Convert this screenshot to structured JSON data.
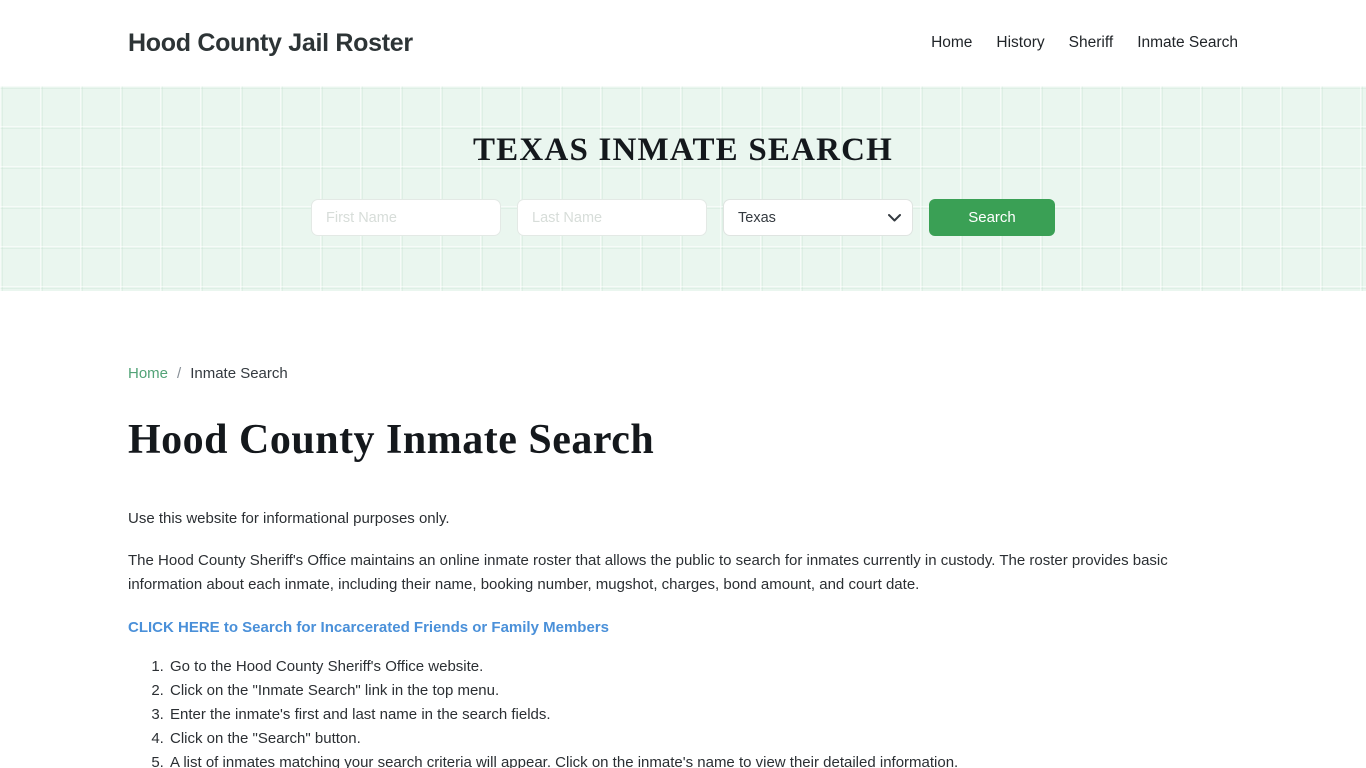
{
  "header": {
    "brand": "Hood County Jail Roster",
    "nav": [
      {
        "label": "Home"
      },
      {
        "label": "History"
      },
      {
        "label": "Sheriff"
      },
      {
        "label": "Inmate Search"
      }
    ]
  },
  "hero": {
    "title": "TEXAS INMATE SEARCH",
    "form": {
      "first_name_placeholder": "First Name",
      "first_name_value": "",
      "last_name_placeholder": "Last Name",
      "last_name_value": "",
      "state_selected": "Texas",
      "state_options": [
        "Texas"
      ],
      "chevron_icon": "chevron-down-icon",
      "search_label": "Search"
    },
    "background_color": "#eaf6ef",
    "button_color": "#3aa055"
  },
  "breadcrumb": {
    "home_label": "Home",
    "separator": "/",
    "current_label": "Inmate Search"
  },
  "main": {
    "page_title": "Hood County Inmate Search",
    "lead": "Use this website for informational purposes only.",
    "body": "The Hood County Sheriff's Office maintains an online inmate roster that allows the public to search for inmates currently in custody. The roster provides basic information about each inmate, including their name, booking number, mugshot, charges, bond amount, and court date.",
    "cta_link": "CLICK HERE to Search for Incarcerated Friends or Family Members",
    "cta_color": "#4a90d9",
    "steps": [
      "Go to the Hood County Sheriff's Office website.",
      "Click on the \"Inmate Search\" link in the top menu.",
      "Enter the inmate's first and last name in the search fields.",
      "Click on the \"Search\" button.",
      "A list of inmates matching your search criteria will appear. Click on the inmate's name to view their detailed information."
    ]
  }
}
